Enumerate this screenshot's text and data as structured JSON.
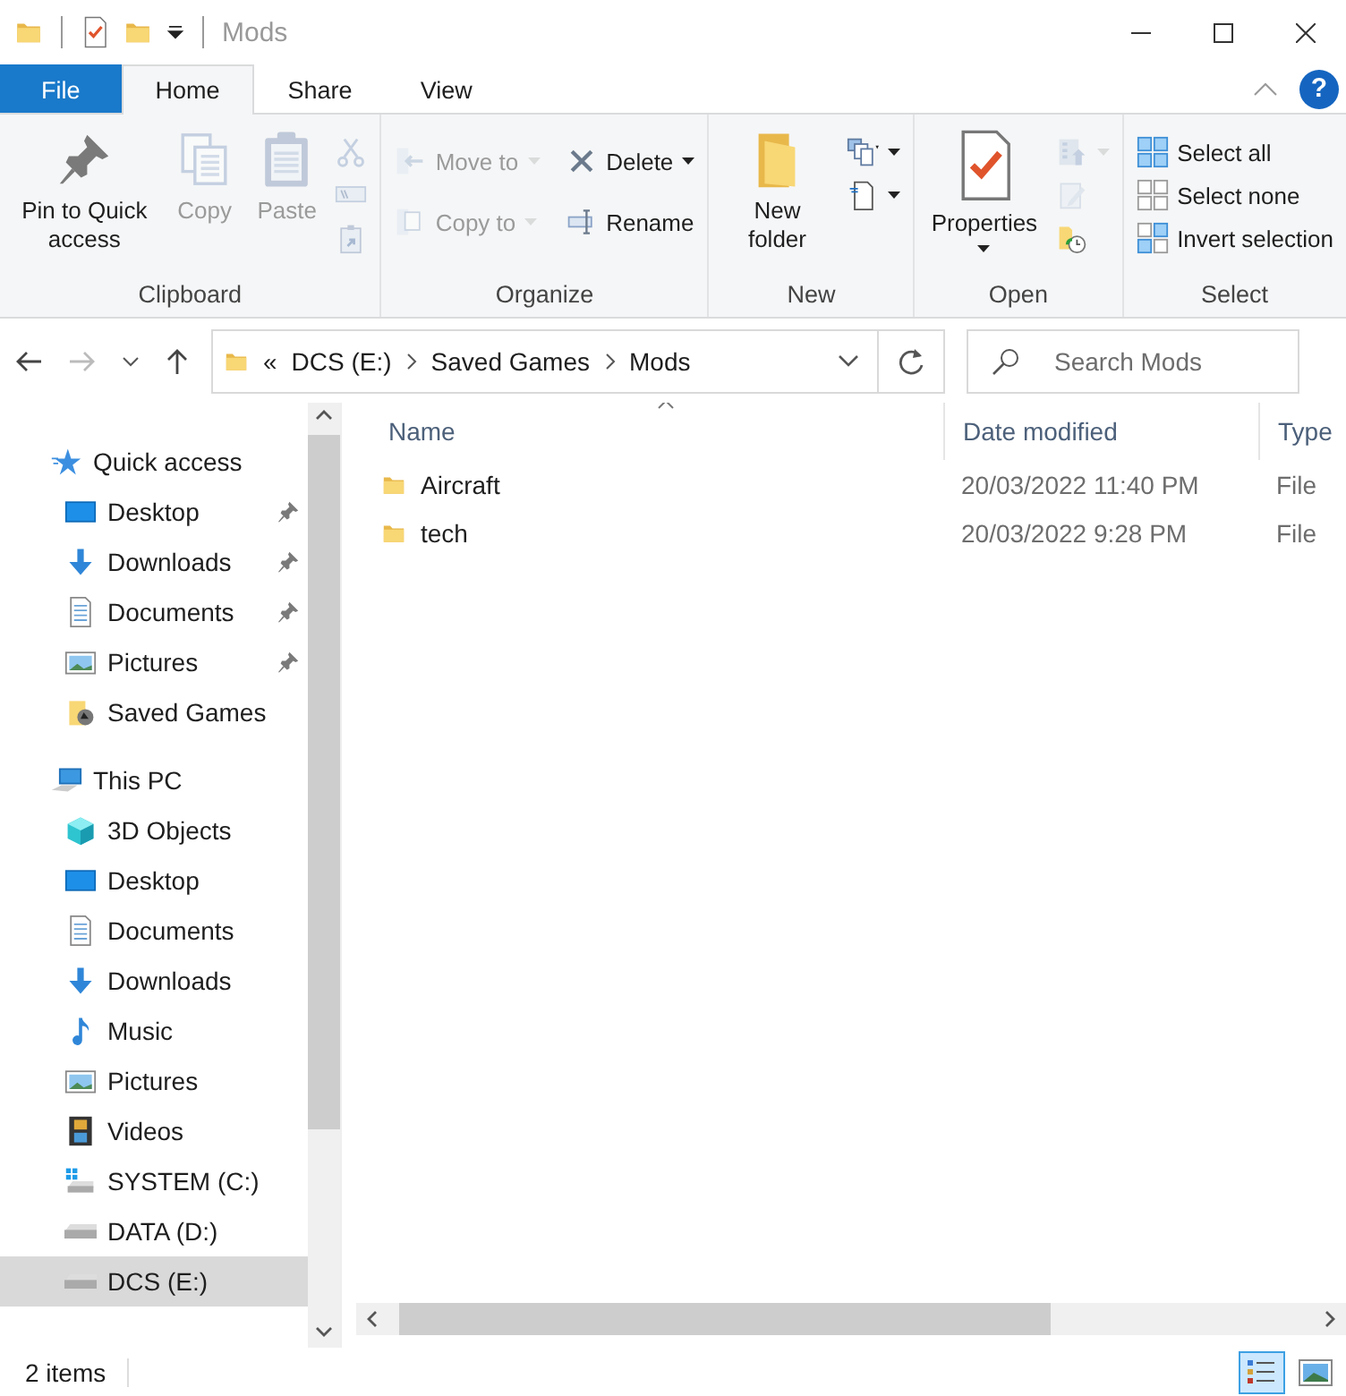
{
  "window": {
    "title": "Mods"
  },
  "help_button": "?",
  "ribbon_tabs": [
    {
      "label": "File",
      "kind": "file",
      "selected": false
    },
    {
      "label": "Home",
      "kind": "tab",
      "selected": true
    },
    {
      "label": "Share",
      "kind": "tab",
      "selected": false
    },
    {
      "label": "View",
      "kind": "tab",
      "selected": false
    }
  ],
  "ribbon_groups": [
    {
      "label": "Clipboard",
      "commands": [
        {
          "label": "Pin to Quick access",
          "kind": "pin",
          "large": true,
          "disabled": false,
          "dropdown": false
        },
        {
          "label": "Copy",
          "kind": "copy",
          "large": true,
          "disabled": true,
          "dropdown": false
        },
        {
          "label": "Paste",
          "kind": "paste",
          "large": true,
          "disabled": true,
          "dropdown": false
        },
        {
          "kind": "cut",
          "large": false,
          "disabled": true,
          "dropdown": false
        },
        {
          "kind": "copypath",
          "large": false,
          "disabled": true,
          "dropdown": false
        },
        {
          "kind": "shortcut",
          "large": false,
          "disabled": true,
          "dropdown": false
        }
      ]
    },
    {
      "label": "Organize",
      "commands": [
        {
          "label": "Move to",
          "kind": "moveto",
          "large": false,
          "disabled": true,
          "dropdown": true
        },
        {
          "label": "Copy to",
          "kind": "copyto",
          "large": false,
          "disabled": true,
          "dropdown": true
        },
        {
          "label": "Delete",
          "kind": "delete",
          "large": false,
          "disabled": false,
          "dropdown": true
        },
        {
          "label": "Rename",
          "kind": "rename",
          "large": false,
          "disabled": false,
          "dropdown": false
        }
      ]
    },
    {
      "label": "New",
      "commands": [
        {
          "label": "New folder",
          "kind": "newfolder",
          "large": true,
          "disabled": false,
          "dropdown": false
        },
        {
          "kind": "newitem",
          "large": false,
          "disabled": false,
          "dropdown": true
        },
        {
          "kind": "easyaccess",
          "large": false,
          "disabled": false,
          "dropdown": true
        }
      ]
    },
    {
      "label": "Open",
      "commands": [
        {
          "label": "Properties",
          "kind": "properties",
          "large": true,
          "disabled": false,
          "dropdown": true
        },
        {
          "kind": "open",
          "large": false,
          "disabled": true,
          "dropdown": true
        },
        {
          "kind": "edit",
          "large": false,
          "disabled": true,
          "dropdown": false
        },
        {
          "kind": "history",
          "large": false,
          "disabled": false,
          "dropdown": false
        }
      ]
    },
    {
      "label": "Select",
      "commands": [
        {
          "label": "Select all",
          "kind": "selectall",
          "large": false,
          "disabled": false,
          "dropdown": false
        },
        {
          "label": "Select none",
          "kind": "selectnone",
          "large": false,
          "disabled": false,
          "dropdown": false
        },
        {
          "label": "Invert selection",
          "kind": "invert",
          "large": false,
          "disabled": false,
          "dropdown": false
        }
      ]
    }
  ],
  "address_bar": {
    "overflow": "«",
    "path": [
      "DCS (E:)",
      "Saved Games",
      "Mods"
    ]
  },
  "search": {
    "placeholder": "Search Mods"
  },
  "navigation": [
    {
      "label": "Quick access",
      "kind": "star",
      "selected": false,
      "children": [
        {
          "label": "Desktop",
          "kind": "desktop",
          "pinned": true,
          "selected": false
        },
        {
          "label": "Downloads",
          "kind": "download",
          "pinned": true,
          "selected": false
        },
        {
          "label": "Documents",
          "kind": "document",
          "pinned": true,
          "selected": false
        },
        {
          "label": "Pictures",
          "kind": "picture",
          "pinned": true,
          "selected": false
        },
        {
          "label": "Saved Games",
          "kind": "games",
          "pinned": false,
          "selected": false
        }
      ]
    },
    {
      "label": "This PC",
      "kind": "pc",
      "selected": false,
      "children": [
        {
          "label": "3D Objects",
          "kind": "cube",
          "pinned": false,
          "selected": false
        },
        {
          "label": "Desktop",
          "kind": "desktop",
          "pinned": false,
          "selected": false
        },
        {
          "label": "Documents",
          "kind": "document",
          "pinned": false,
          "selected": false
        },
        {
          "label": "Downloads",
          "kind": "download",
          "pinned": false,
          "selected": false
        },
        {
          "label": "Music",
          "kind": "music",
          "pinned": false,
          "selected": false
        },
        {
          "label": "Pictures",
          "kind": "picture",
          "pinned": false,
          "selected": false
        },
        {
          "label": "Videos",
          "kind": "video",
          "pinned": false,
          "selected": false
        },
        {
          "label": "SYSTEM (C:)",
          "kind": "windrive",
          "pinned": false,
          "selected": false
        },
        {
          "label": "DATA (D:)",
          "kind": "drive",
          "pinned": false,
          "selected": false
        },
        {
          "label": "DCS (E:)",
          "kind": "drive",
          "pinned": false,
          "selected": true
        }
      ]
    }
  ],
  "file_list": {
    "columns": [
      "Name",
      "Date modified",
      "Type"
    ],
    "rows": [
      {
        "name": "Aircraft",
        "date_modified": "20/03/2022 11:40 PM",
        "type": "File"
      },
      {
        "name": "tech",
        "date_modified": "20/03/2022 9:28 PM",
        "type": "File"
      }
    ]
  },
  "status_bar": {
    "item_count": "2 items",
    "views": [
      {
        "kind": "details",
        "selected": true
      },
      {
        "kind": "large",
        "selected": false
      }
    ]
  }
}
